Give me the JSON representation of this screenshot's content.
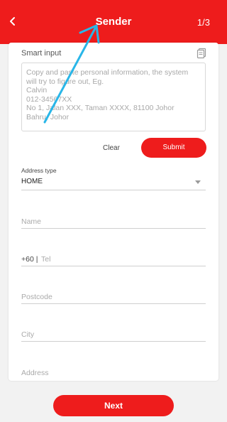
{
  "header": {
    "title": "Sender",
    "step": "1/3",
    "back_icon": "chevron-left-icon"
  },
  "smart_input": {
    "label": "Smart input",
    "copy_icon": "copy-icon",
    "placeholder_lines": [
      "Copy and paste personal information, the system",
      "will try to figure out, Eg.",
      "Calvin",
      "012-34567XX",
      "No 1, Jalan XXX, Taman XXXX, 81100 Johor",
      "Bahru, Johor"
    ],
    "clear_label": "Clear",
    "submit_label": "Submit"
  },
  "address_type": {
    "label": "Address type",
    "value": "HOME"
  },
  "fields": {
    "name_placeholder": "Name",
    "tel_prefix": "+60 |",
    "tel_placeholder": "Tel",
    "postcode_placeholder": "Postcode",
    "city_placeholder": "City",
    "address_placeholder": "Address"
  },
  "footer": {
    "next_label": "Next"
  },
  "colors": {
    "brand": "#ee1c1c",
    "background": "#f2f2f2",
    "annotation_arrow": "#29b6e8"
  }
}
